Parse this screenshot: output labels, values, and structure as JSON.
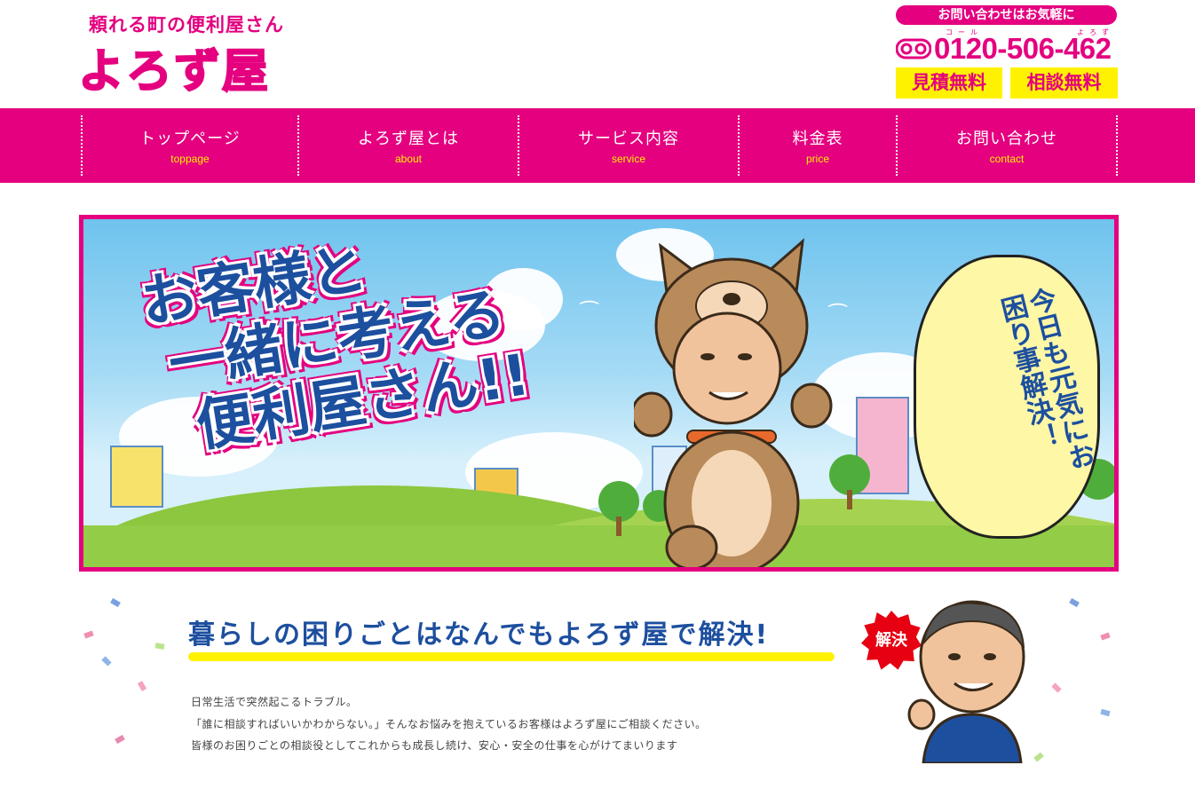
{
  "header": {
    "tagline": "頼れる町の便利屋さん",
    "logo_text": "よろず屋",
    "contact_pill": "お問い合わせはお気軽に",
    "phone_ruby": [
      "コール",
      "よろず"
    ],
    "phone": "0120-506-462",
    "badges": [
      "見積無料",
      "相談無料"
    ]
  },
  "nav": {
    "items": [
      {
        "jp": "トップページ",
        "en": "toppage"
      },
      {
        "jp": "よろず屋とは",
        "en": "about"
      },
      {
        "jp": "サービス内容",
        "en": "service"
      },
      {
        "jp": "料金表",
        "en": "price"
      },
      {
        "jp": "お問い合わせ",
        "en": "contact"
      }
    ]
  },
  "hero": {
    "headline_lines": [
      "お客様と",
      "一緒に考える",
      "便利屋さん!!"
    ],
    "bubble_text": "今日も元気にお困り事解決！"
  },
  "section": {
    "title": "暮らしの困りごとはなんでもよろず屋で解決!",
    "badge": "解決",
    "paragraphs": [
      "日常生活で突然起こるトラブル。",
      "「誰に相談すればいいかわからない。」そんなお悩みを抱えているお客様はよろず屋にご相談ください。",
      "皆様のお困りごとの相談役としてこれからも成長し続け、安心・安全の仕事を心がけてまいります"
    ]
  },
  "colors": {
    "brand_pink": "#e4007f",
    "accent_yellow": "#fff200",
    "headline_blue": "#1d4f9f"
  }
}
